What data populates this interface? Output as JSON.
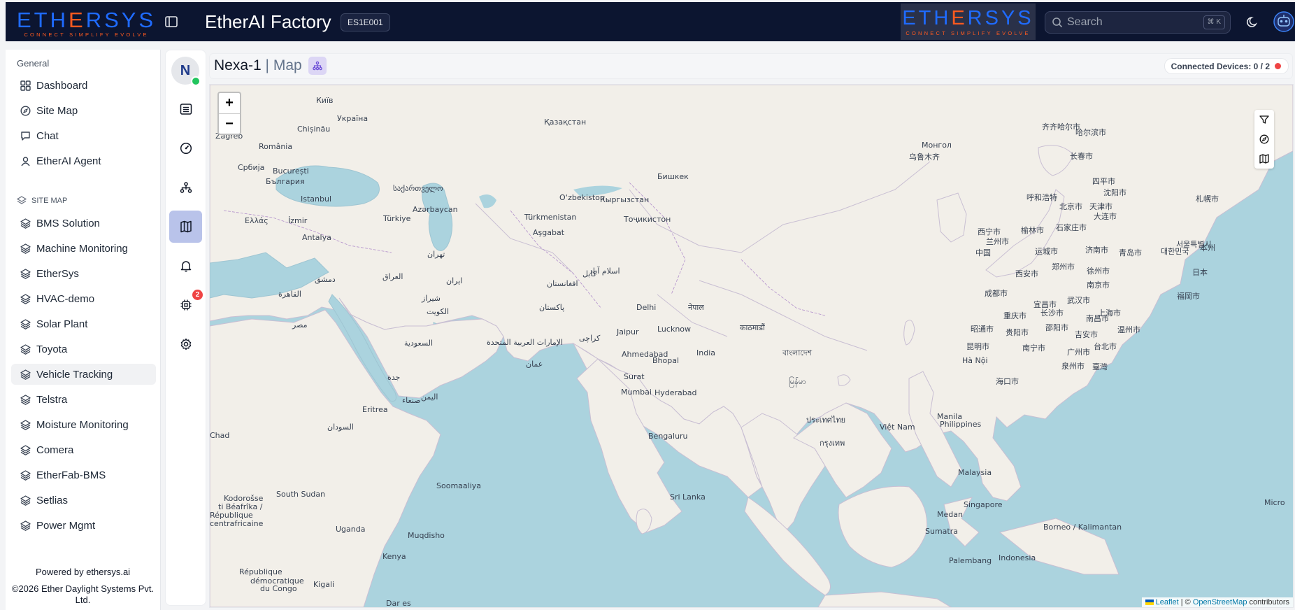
{
  "header": {
    "logo_text": "ETHERSYS",
    "logo_tagline": "CONNECT SIMPLIFY EVOLVE",
    "app_title": "EtherAI Factory",
    "site_code": "ES1E001",
    "search_placeholder": "Search",
    "search_shortcut": "⌘ K"
  },
  "sidebar": {
    "general_label": "General",
    "general_items": [
      {
        "label": "Dashboard",
        "icon": "dashboard-icon"
      },
      {
        "label": "Site Map",
        "icon": "compass-icon"
      },
      {
        "label": "Chat",
        "icon": "chat-icon"
      },
      {
        "label": "EtherAI Agent",
        "icon": "agent-icon"
      }
    ],
    "site_map_label": "SITE MAP",
    "site_items": [
      {
        "label": "BMS Solution"
      },
      {
        "label": "Machine Monitoring"
      },
      {
        "label": "EtherSys"
      },
      {
        "label": "HVAC-demo"
      },
      {
        "label": "Solar Plant"
      },
      {
        "label": "Toyota"
      },
      {
        "label": "Vehicle Tracking",
        "active": true
      },
      {
        "label": "Telstra"
      },
      {
        "label": "Moisture Monitoring"
      },
      {
        "label": "Comera"
      },
      {
        "label": "EtherFab-BMS"
      },
      {
        "label": "Setlias"
      },
      {
        "label": "Power Mgmt"
      }
    ],
    "powered_by": "Powered by ethersys.ai",
    "copyright_line1": "©2026 Ether Daylight Systems Pvt.",
    "copyright_line2": "Ltd."
  },
  "rail": {
    "avatar_initial": "N",
    "notification_count": "2",
    "active_item": "map"
  },
  "main": {
    "device_name": "Nexa-1",
    "separator": "|",
    "page_name": "Map",
    "connected_label": "Connected Devices: 0 / 2",
    "connected_status_color": "#ef4444"
  },
  "map": {
    "zoom_in": "+",
    "zoom_out": "−",
    "attribution": {
      "leaflet": "Leaflet",
      "sep": " | © ",
      "osm": "OpenStreetMap",
      "contributors": " contributors"
    },
    "labels": [
      "Київ",
      "Україна",
      "Chișinău",
      "România",
      "Zagreb",
      "București",
      "Србија",
      "България",
      "Istanbul",
      "საქართველო",
      "Türkiye",
      "Azərbaycan",
      "Ελλάς",
      "İzmir",
      "Antalya",
      "Қазақстан",
      "O‘zbekiston",
      "Türkmenistan",
      "Aşgabat",
      "Кыргызстан",
      "Тоҷикистон",
      "Бишкек",
      "Монгол",
      "乌鲁木齐",
      "齐齐哈尔市",
      "哈尔滨市",
      "长春市",
      "四平市",
      "沈阳市",
      "呼和浩特",
      "北京市",
      "天津市",
      "大连市",
      "榆林市",
      "石家庄市",
      "西宁市",
      "兰州市",
      "中国",
      "运城市",
      "济南市",
      "青岛市",
      "郑州市",
      "徐州市",
      "西安市",
      "南京市",
      "成都市",
      "宜昌市",
      "武汉市",
      "上海市",
      "重庆市",
      "长沙市",
      "南昌市",
      "昭通市",
      "贵阳市",
      "邵阳市",
      "吉安市",
      "温州市",
      "台北市",
      "昆明市",
      "南宁市",
      "广州市",
      "泉州市",
      "臺灣",
      "Hà Nội",
      "海口市",
      "日本",
      "札幌市",
      "本州",
      "대한민국",
      "서울특별시",
      "福岡市",
      "دمشق",
      "العراق",
      "ایران",
      "تهران",
      "شیراز",
      "الكويت",
      "القاهرة",
      "مصر",
      "السعودية",
      "الإمارات العربية المتحدة",
      "عمان",
      "جدة",
      "اليمن",
      "صنعاء",
      "افغانستان",
      "کابل",
      "اسلام آباد",
      "پاکستان",
      "کراچی",
      "Delhi",
      "Jaipur",
      "Lucknow",
      "नेपाल",
      "काठमाडौं",
      "India",
      "Ahmedabad",
      "Bhopal",
      "Surat",
      "Mumbai",
      "Hyderabad",
      "Bengaluru",
      "Sri Lanka",
      "বাংলাদেশ",
      "မြန်မာ",
      "ประเทศไทย",
      "กรุงเทพ",
      "Việt Nam",
      "Manila",
      "Philippines",
      "Malaysia",
      "Singapore",
      "Medan",
      "Sumatra",
      "Borneo / Kalimantan",
      "Palembang",
      "Indonesia",
      "السودان",
      "Eritrea",
      "Soomaaliya",
      "Muqdisho",
      "Kenya",
      "Uganda",
      "South Sudan",
      "Kigali",
      "Chad",
      "Kodorošse",
      "ti Béafrîka /",
      "République",
      "centrafricaine",
      "République",
      "démocratique",
      "du Congo",
      "Dar es",
      "Micro"
    ]
  }
}
